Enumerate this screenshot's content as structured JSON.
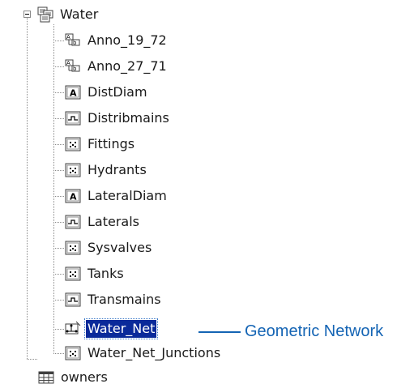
{
  "tree": {
    "root": {
      "label": "Water",
      "icon": "feature-dataset-icon",
      "expanded": true
    },
    "children": [
      {
        "label": "Anno_19_72",
        "icon": "annotation-class-icon"
      },
      {
        "label": "Anno_27_71",
        "icon": "annotation-class-icon"
      },
      {
        "label": "DistDiam",
        "icon": "dimension-label-class-icon"
      },
      {
        "label": "Distribmains",
        "icon": "line-feature-class-icon"
      },
      {
        "label": "Fittings",
        "icon": "point-feature-class-icon"
      },
      {
        "label": "Hydrants",
        "icon": "point-feature-class-icon"
      },
      {
        "label": "LateralDiam",
        "icon": "dimension-label-class-icon"
      },
      {
        "label": "Laterals",
        "icon": "line-feature-class-icon"
      },
      {
        "label": "Sysvalves",
        "icon": "point-feature-class-icon"
      },
      {
        "label": "Tanks",
        "icon": "point-feature-class-icon"
      },
      {
        "label": "Transmains",
        "icon": "line-feature-class-icon"
      },
      {
        "label": "Water_Net",
        "icon": "geometric-network-icon",
        "selected": true
      },
      {
        "label": "Water_Net_Junctions",
        "icon": "point-feature-class-icon"
      }
    ],
    "sibling": {
      "label": "owners",
      "icon": "table-icon"
    }
  },
  "callout": {
    "text": "Geometric Network",
    "color": "#1464b4"
  },
  "colors": {
    "selection": "#0a2a9a",
    "connector": "#8a8a8a"
  }
}
